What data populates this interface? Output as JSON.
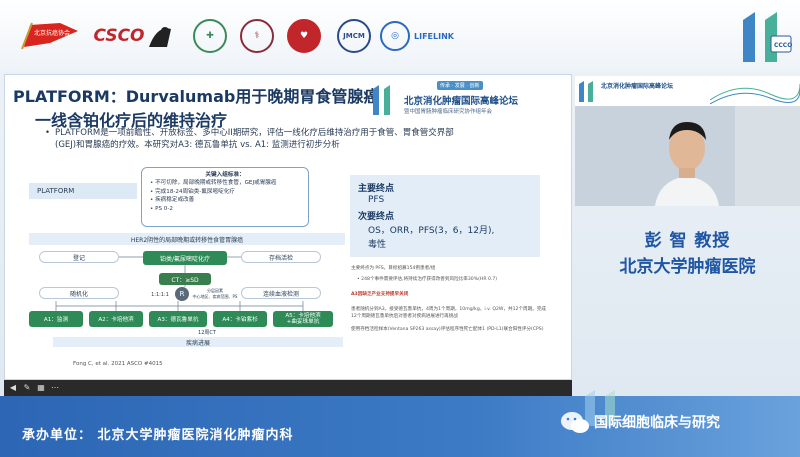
{
  "logos": {
    "csco": "CSCO",
    "jmcm": "JMCM",
    "lifelink": "LIFELINK",
    "red_flag_text": "北京抗癌协会",
    "big_number": "11",
    "big_number_sub": "CCCO"
  },
  "slide": {
    "title": "PLATFORM：Durvalumab用于晚期胃食管腺癌",
    "subtitle": "一线含铂化疗后的维持治疗",
    "bullet_lines": [
      "PLATFORM是一项前瞻性、开放标签、多中心II期研究，评估一线化疗后维持治疗用于食管、胃食管交界部",
      "(GEJ)和胃腺癌的疗效。本研究对A3: 德瓦鲁单抗 vs. A1: 监测进行初步分析"
    ],
    "conference_title": "北京消化肿瘤国际高峰论坛",
    "conference_badge": "传承 · 发展 · 创新",
    "conference_subtitle": "暨中国胃肠肿瘤临床研究协作组年会",
    "diagram": {
      "platform_label": "PLATFORM",
      "criteria_header": "关键入组标准：",
      "criteria_items": [
        "• 不可切除，局部晚期或转移性食管，GEJ或胃腺癌",
        "• 完成18-24周铂类-氟尿嘧啶化疗",
        "• 疾病稳定或改善",
        "• PS 0-2"
      ],
      "her2_banner": "HER2阴性的局部晚期或转移性食管胃腺癌",
      "register": "登记",
      "chemo": "铂类/氟尿嘧啶化疗",
      "tissue": "存档活检",
      "ct": "CT：≥SD",
      "randomize": "随机化",
      "ratio": "1:1:1:1",
      "r_label": "R",
      "strat": "分层因素\n中心地区、疾病范围、PS",
      "ctdna": "连续血液检测",
      "arms": [
        "A1：监测",
        "A2：卡培他滨",
        "A3：德瓦鲁单抗",
        "A4：卡铂紫杉",
        "A5：卡培他滨\n+曲妥珠单抗"
      ],
      "ct_interval": "12周CT",
      "progression": "疾病进展"
    },
    "reference": "Fong C, et al. 2021 ASCO #4015",
    "endpoints": {
      "primary_label": "主要终点",
      "primary_value": "PFS",
      "secondary_label": "次要终点",
      "secondary_value_1": "OS，ORR，PFS(3，6，12月),",
      "secondary_value_2": "毒性"
    },
    "notes": [
      "主要终点为 PFS。目标招募154例患者/组",
      "• 248个事件需要评估,将持续治疗获得改善到风险比率30%(HR 0.7)",
      "A3因缺乏产业支持提早关闭",
      "患者随机分到A3，接受德瓦鲁单抗，4周为1个周期，10mg/kg，i.v. Q2W，共12个周期。完成12个周期德瓦鲁单抗后对患者对疾病进展进行再挑战",
      "使用存档活检样本(Ventana SP263 assay)评估程序性死亡配体1 (PD-L1)联合阳性评分(CPS)"
    ]
  },
  "right_panel": {
    "mini_title": "北京消化肿瘤国际高峰论坛",
    "speaker_name": "彭 智  教授",
    "speaker_org": "北京大学肿瘤医院"
  },
  "banner": {
    "host": "承办单位：  北京大学肿瘤医院消化肿瘤内科",
    "wechat_label": "国际细胞临床与研究"
  },
  "colors": {
    "title_blue": "#1b3a63",
    "speaker_blue": "#1f56a4",
    "arm_green": "#2e8b57",
    "banner_blue": "#2c66b4"
  }
}
